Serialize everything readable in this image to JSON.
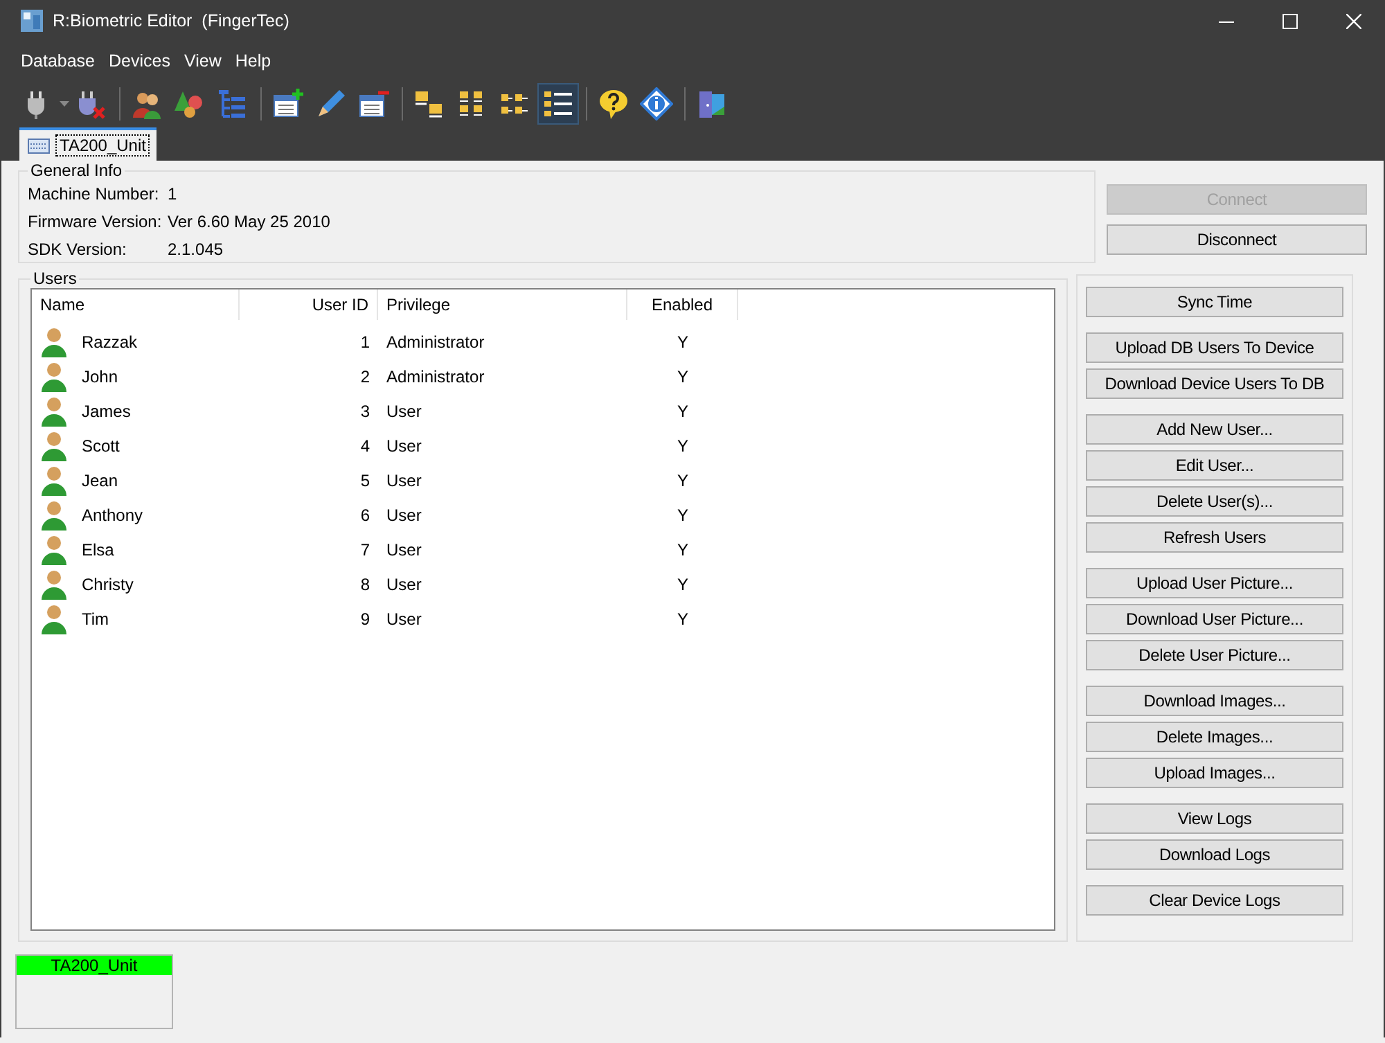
{
  "window": {
    "title": "R:Biometric Editor  (FingerTec)"
  },
  "menu": [
    "Database",
    "Devices",
    "View",
    "Help"
  ],
  "toolbar": [
    [
      {
        "selected": false
      },
      {
        "selected": false
      }
    ],
    [
      {
        "selected": false
      },
      {
        "selected": false
      },
      {
        "selected": false
      }
    ],
    [
      {
        "selected": false
      },
      {
        "selected": false
      },
      {
        "selected": false
      }
    ],
    [
      {
        "selected": false
      },
      {
        "selected": false
      },
      {
        "selected": false
      },
      {
        "selected": true
      }
    ],
    [
      {
        "selected": false
      },
      {
        "selected": false
      }
    ],
    [
      {
        "selected": false
      }
    ]
  ],
  "tabs": [
    {
      "label": "TA200_Unit",
      "selected": true
    }
  ],
  "general_info": {
    "title": "General Info",
    "fields": [
      {
        "label": "Machine Number:",
        "value": "1"
      },
      {
        "label": "Firmware Version:",
        "value": "Ver 6.60 May 25 2010"
      },
      {
        "label": "SDK Version:",
        "value": "2.1.045"
      }
    ]
  },
  "connection_buttons": [
    {
      "label": "Connect",
      "disabled": true
    },
    {
      "label": "Disconnect",
      "disabled": false
    }
  ],
  "users": {
    "title": "Users",
    "columns": [
      "Name",
      "User ID",
      "Privilege",
      "Enabled"
    ],
    "rows": [
      {
        "name": "Razzak",
        "id": "1",
        "privilege": "Administrator",
        "enabled": "Y"
      },
      {
        "name": "John",
        "id": "2",
        "privilege": "Administrator",
        "enabled": "Y"
      },
      {
        "name": "James",
        "id": "3",
        "privilege": "User",
        "enabled": "Y"
      },
      {
        "name": "Scott",
        "id": "4",
        "privilege": "User",
        "enabled": "Y"
      },
      {
        "name": "Jean",
        "id": "5",
        "privilege": "User",
        "enabled": "Y"
      },
      {
        "name": "Anthony",
        "id": "6",
        "privilege": "User",
        "enabled": "Y"
      },
      {
        "name": "Elsa",
        "id": "7",
        "privilege": "User",
        "enabled": "Y"
      },
      {
        "name": "Christy",
        "id": "8",
        "privilege": "User",
        "enabled": "Y"
      },
      {
        "name": "Tim",
        "id": "9",
        "privilege": "User",
        "enabled": "Y"
      }
    ]
  },
  "action_groups": [
    [
      "Sync Time"
    ],
    [
      "Upload DB Users To Device",
      "Download Device Users To DB"
    ],
    [
      "Add New User...",
      "Edit User...",
      "Delete User(s)...",
      "Refresh Users"
    ],
    [
      "Upload User Picture...",
      "Download User Picture...",
      "Delete User Picture..."
    ],
    [
      "Download Images...",
      "Delete Images...",
      "Upload Images..."
    ],
    [
      "View Logs",
      "Download Logs"
    ],
    [
      "Clear Device Logs"
    ]
  ],
  "device_tiles": [
    {
      "label": "TA200_Unit",
      "color": "#00ff00"
    }
  ]
}
